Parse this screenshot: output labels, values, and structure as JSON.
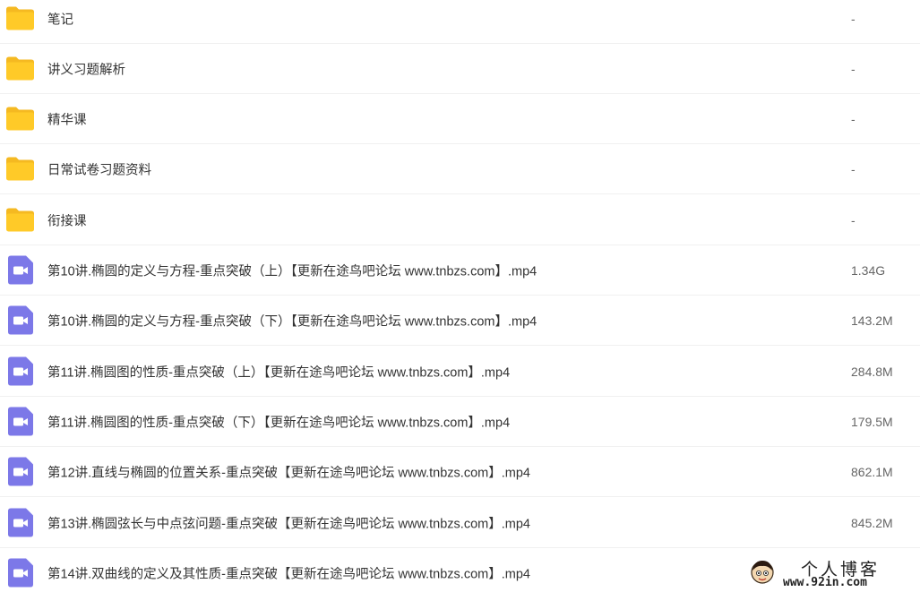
{
  "files": [
    {
      "name": "笔记",
      "size": "-",
      "type": "folder",
      "icon": "folder-icon"
    },
    {
      "name": "讲义习题解析",
      "size": "-",
      "type": "folder",
      "icon": "folder-icon"
    },
    {
      "name": "精华课",
      "size": "-",
      "type": "folder",
      "icon": "folder-icon"
    },
    {
      "name": "日常试卷习题资料",
      "size": "-",
      "type": "folder",
      "icon": "folder-icon"
    },
    {
      "name": "衔接课",
      "size": "-",
      "type": "folder",
      "icon": "folder-icon"
    },
    {
      "name": "第10讲.椭圆的定义与方程-重点突破（上）【更新在途鸟吧论坛 www.tnbzs.com】.mp4",
      "size": "1.34G",
      "type": "video",
      "icon": "video-file-icon"
    },
    {
      "name": "第10讲.椭圆的定义与方程-重点突破（下）【更新在途鸟吧论坛 www.tnbzs.com】.mp4",
      "size": "143.2M",
      "type": "video",
      "icon": "video-file-icon"
    },
    {
      "name": "第11讲.椭圆图的性质-重点突破（上）【更新在途鸟吧论坛 www.tnbzs.com】.mp4",
      "size": "284.8M",
      "type": "video",
      "icon": "video-file-icon"
    },
    {
      "name": "第11讲.椭圆图的性质-重点突破（下）【更新在途鸟吧论坛 www.tnbzs.com】.mp4",
      "size": "179.5M",
      "type": "video",
      "icon": "video-file-icon"
    },
    {
      "name": "第12讲.直线与椭圆的位置关系-重点突破【更新在途鸟吧论坛 www.tnbzs.com】.mp4",
      "size": "862.1M",
      "type": "video",
      "icon": "video-file-icon"
    },
    {
      "name": "第13讲.椭圆弦长与中点弦问题-重点突破【更新在途鸟吧论坛 www.tnbzs.com】.mp4",
      "size": "845.2M",
      "type": "video",
      "icon": "video-file-icon"
    },
    {
      "name": "第14讲.双曲线的定义及其性质-重点突破【更新在途鸟吧论坛 www.tnbzs.com】.mp4",
      "size": "",
      "type": "video",
      "icon": "video-file-icon"
    }
  ],
  "watermark": {
    "title": "个人博客",
    "url": "www.92in.com"
  },
  "colors": {
    "folder": "#FFCA28",
    "folder_tab": "#F5B921",
    "video": "#7C78E8"
  }
}
